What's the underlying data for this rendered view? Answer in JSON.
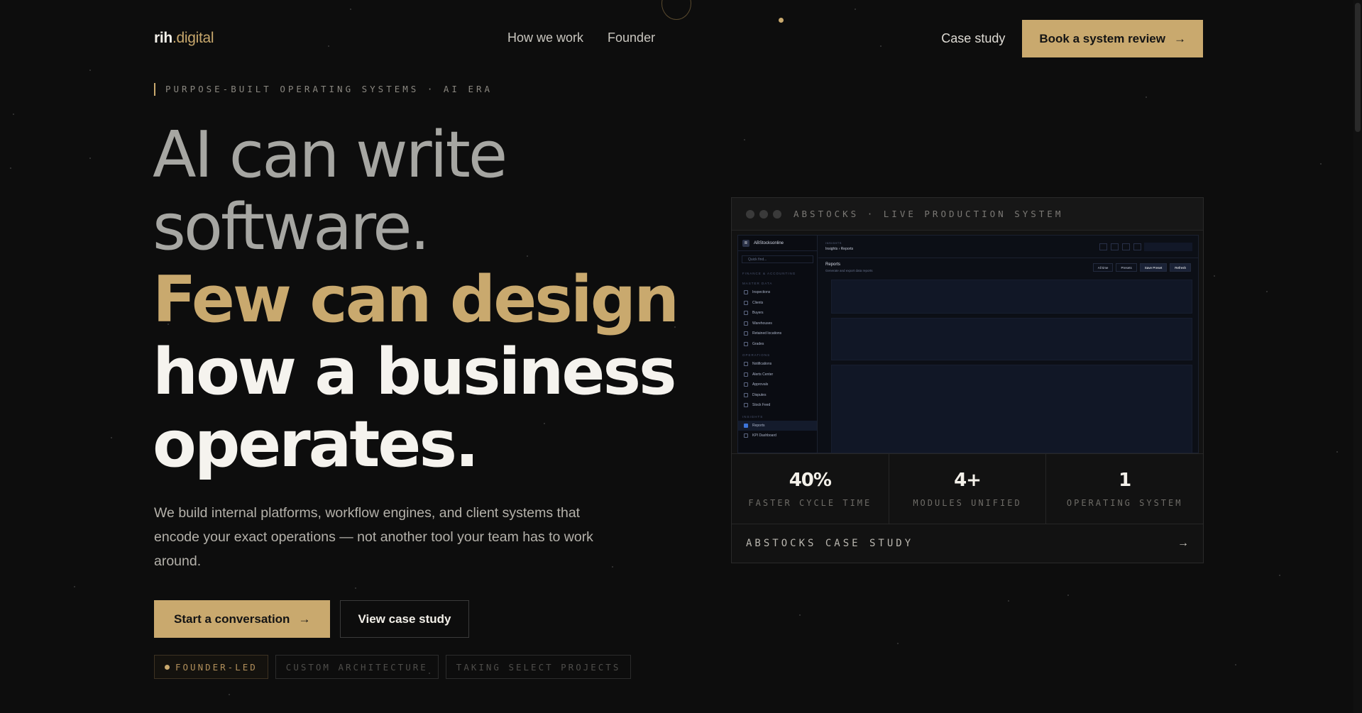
{
  "brand": {
    "logo_main": "rih",
    "logo_accent": ".digital"
  },
  "nav": {
    "links": [
      "How we work",
      "Founder"
    ],
    "case_study": "Case study",
    "cta": "Book a system review"
  },
  "hero": {
    "eyebrow": "PURPOSE-BUILT OPERATING SYSTEMS · AI ERA",
    "headline": {
      "line1": "AI can write",
      "line2": "software.",
      "line3": "Few can design",
      "line4": "how a business",
      "line5": "operates."
    },
    "lede": "We build internal platforms, workflow engines, and client systems that encode your exact operations — not another tool your team has to work around.",
    "cta_primary": "Start a conversation",
    "cta_secondary": "View case study",
    "tags": [
      "FOUNDER-LED",
      "CUSTOM ARCHITECTURE",
      "TAKING SELECT PROJECTS"
    ]
  },
  "case_card": {
    "title": "ABSTOCKS · LIVE PRODUCTION SYSTEM",
    "screenshot": {
      "brand": "ABStocksonline",
      "search_placeholder": "Quick find...",
      "section_finance": "FINANCE & ACCOUNTING",
      "section_master": "MASTER DATA",
      "master_items": [
        "Inspections",
        "Clients",
        "Buyers",
        "Warehouses",
        "Retained locations",
        "Grades"
      ],
      "section_operations": "OPERATIONS",
      "operations_items": [
        "Notifications",
        "Alerts Center",
        "Approvals",
        "Disputes",
        "Stock Feed"
      ],
      "section_insights": "INSIGHTS",
      "insights_items": [
        "Reports",
        "KPI Dashboard"
      ],
      "crumb_top": "INSIGHTS",
      "crumb": "Insights › Reports",
      "page_title": "Reports",
      "page_subtitle": "Generate and export data reports",
      "buttons": [
        "All time",
        "Presets",
        "Save Preset",
        "Refresh"
      ]
    },
    "stats": [
      {
        "value": "40%",
        "label": "FASTER CYCLE TIME"
      },
      {
        "value": "4+",
        "label": "MODULES UNIFIED"
      },
      {
        "value": "1",
        "label": "OPERATING SYSTEM"
      }
    ],
    "footer": "ABSTOCKS CASE STUDY"
  },
  "colors": {
    "background": "#0d0d0d",
    "accent": "#c9a96e",
    "text": "#f2efe8"
  },
  "icons": {
    "arrow": "arrow-right-icon"
  }
}
